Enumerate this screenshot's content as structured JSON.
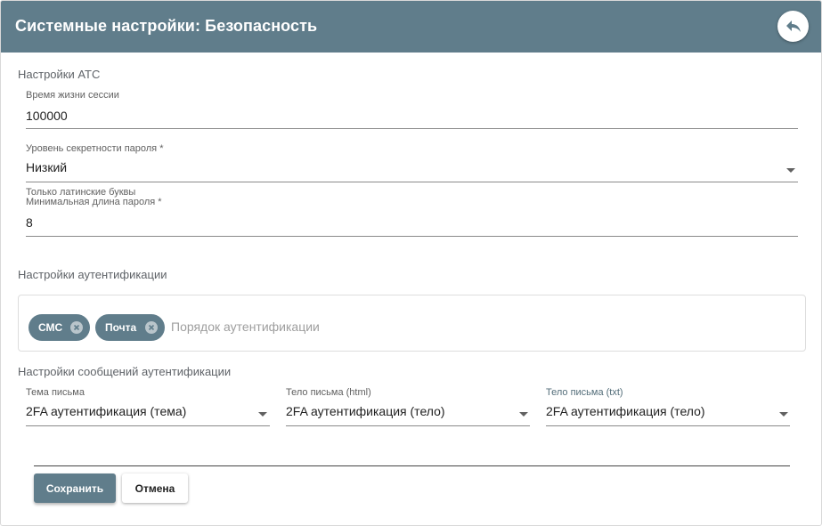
{
  "header": {
    "title": "Системные настройки: Безопасность",
    "back_icon": "reply-arrow-icon"
  },
  "pbx_settings": {
    "section_title": "Настройки АТС",
    "session_lifetime": {
      "label": "Время жизни сессии",
      "value": "100000"
    },
    "password_level": {
      "label": "Уровень секретности пароля *",
      "value": "Низкий"
    },
    "latin_only_hint": "Только латинские буквы",
    "min_password_length": {
      "label": "Минимальная длина пароля *",
      "value": "8"
    }
  },
  "auth_settings": {
    "section_title": "Настройки аутентификации",
    "chips": [
      {
        "label": "СМС"
      },
      {
        "label": "Почта"
      }
    ],
    "placeholder": "Порядок аутентификации"
  },
  "auth_messages": {
    "section_title": "Настройки сообщений аутентификации",
    "subject": {
      "label": "Тема письма",
      "value": "2FA аутентификация (тема)"
    },
    "body_html": {
      "label": "Тело письма (html)",
      "value": "2FA аутентификация (тело)"
    },
    "body_txt": {
      "label": "Тело письма (txt)",
      "value": "2FA аутентификация (тело)"
    }
  },
  "actions": {
    "save_label": "Сохранить",
    "cancel_label": "Отмена"
  },
  "colors": {
    "primary": "#607d8b",
    "chip_close": "#b9c5cb"
  }
}
